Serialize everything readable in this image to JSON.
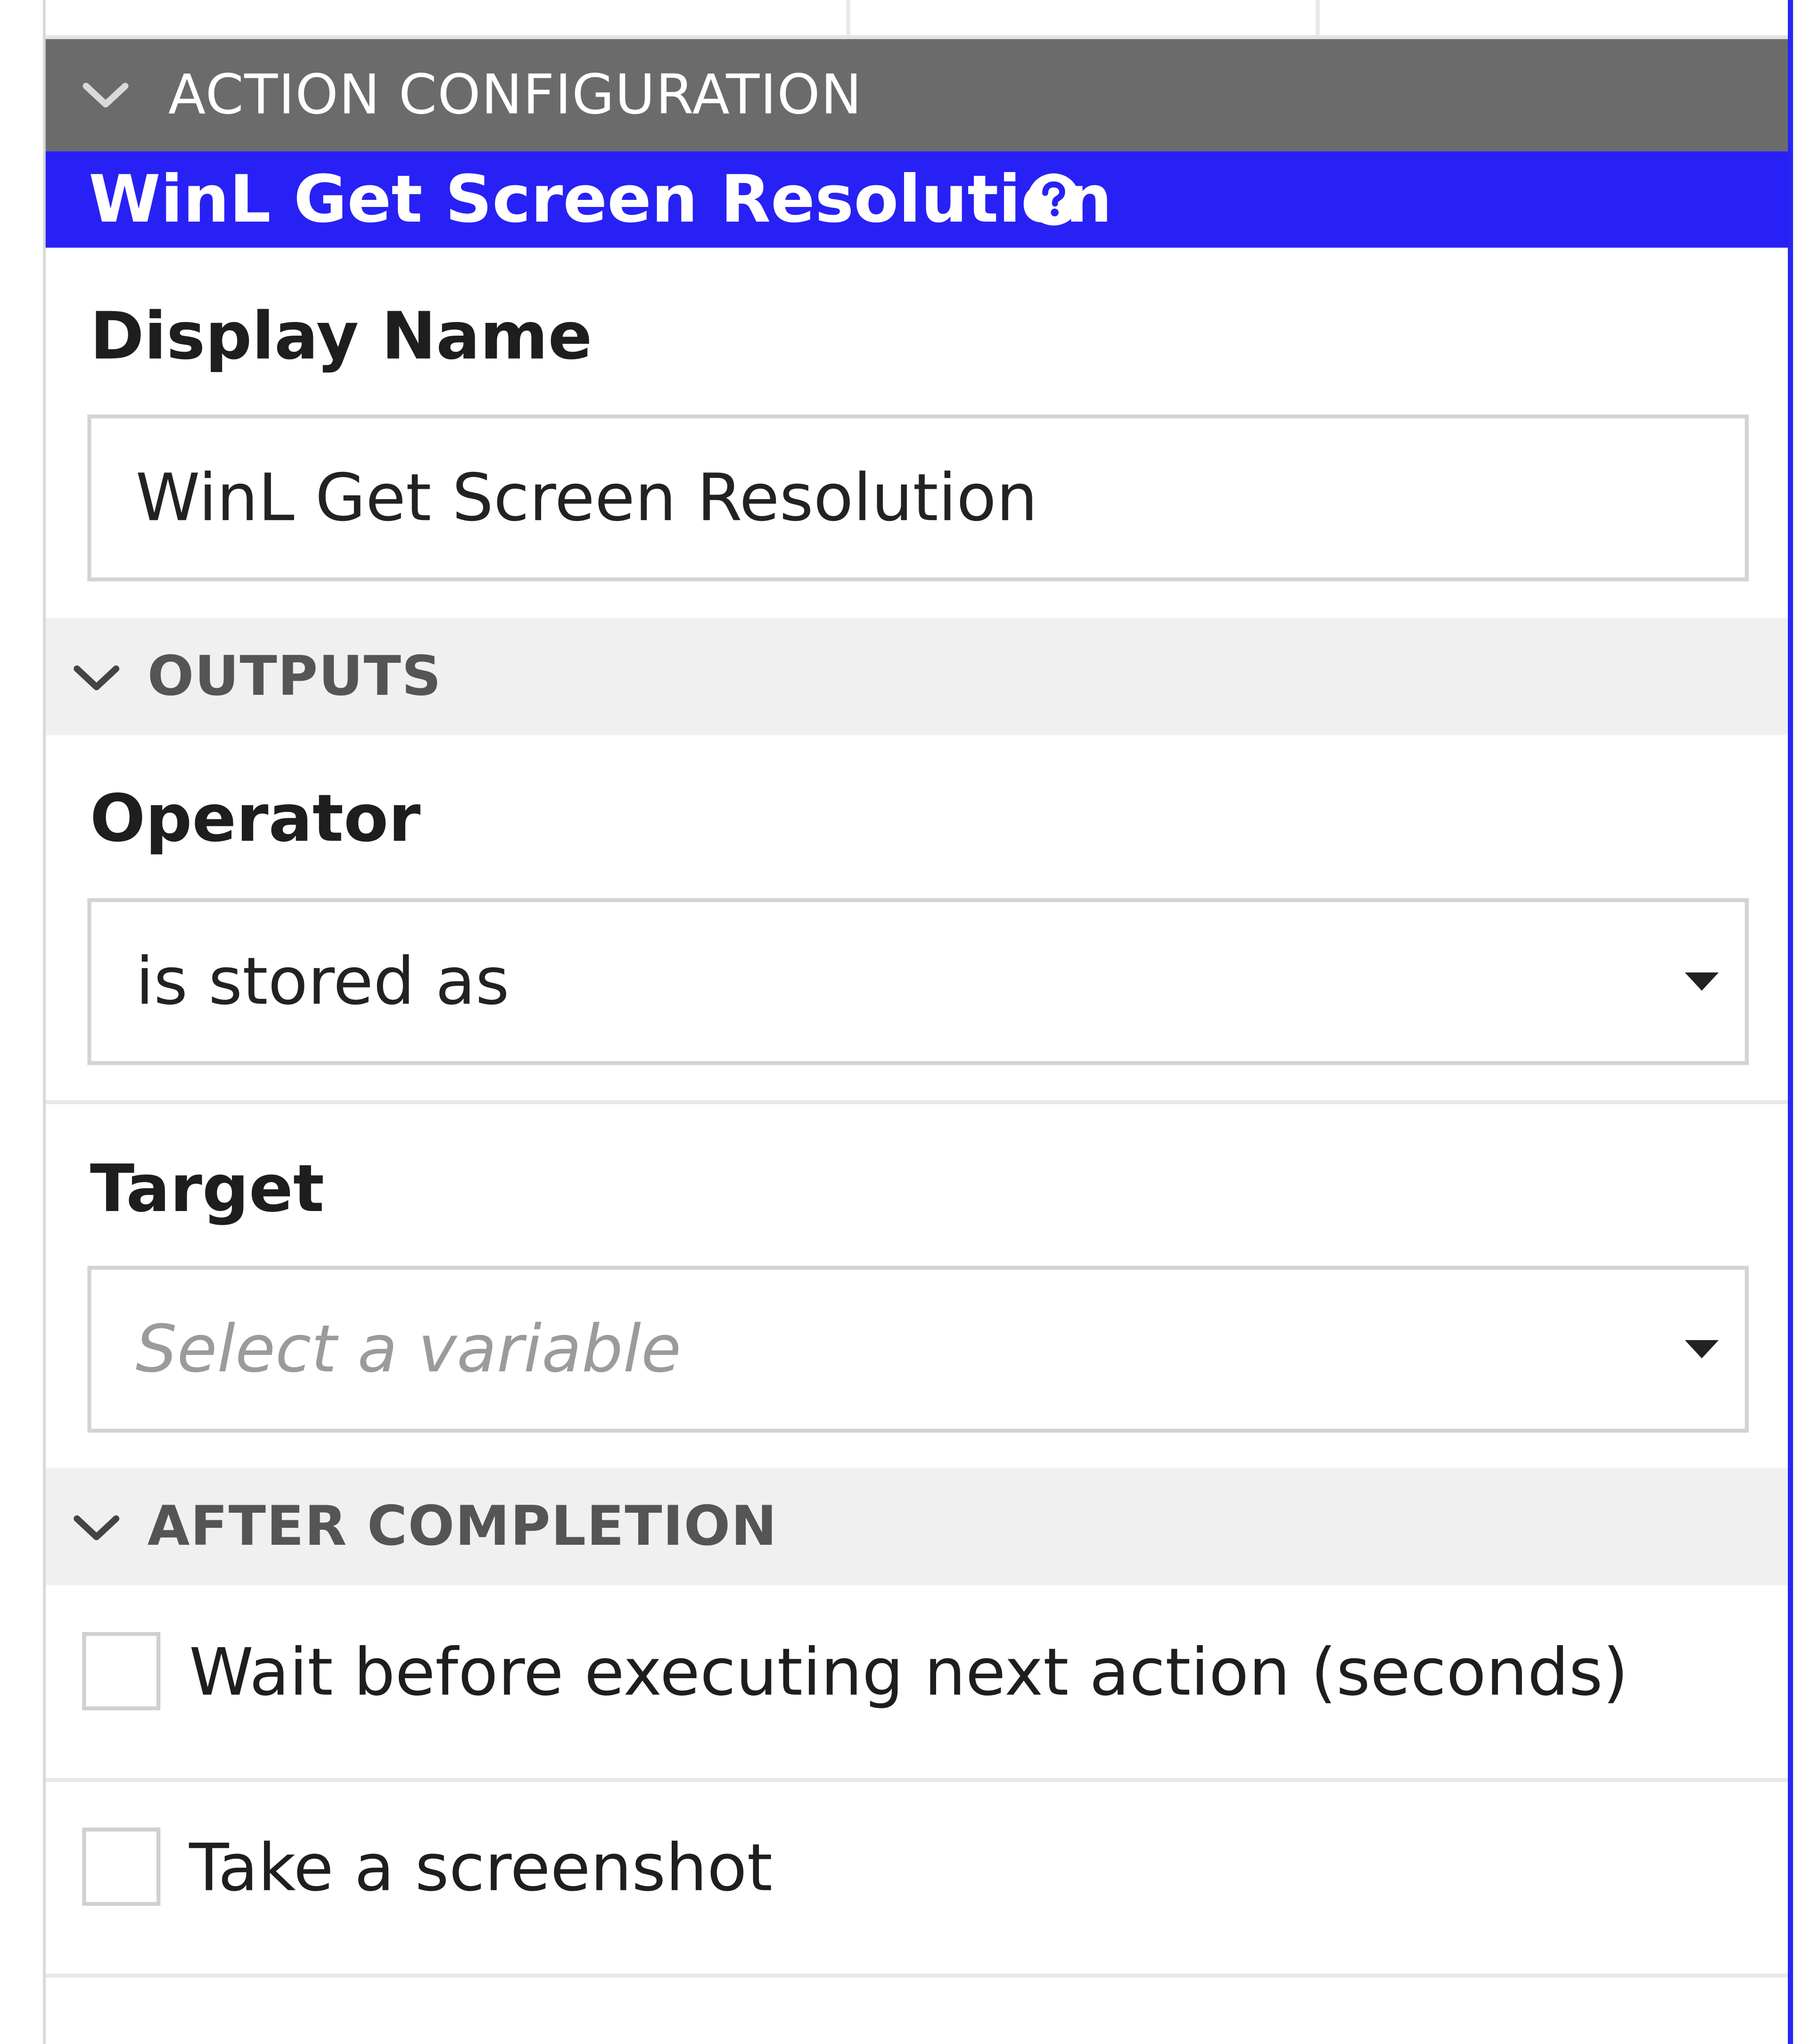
{
  "panel": {
    "header": {
      "title": "ACTION CONFIGURATION",
      "icon": "chevron-down-icon"
    },
    "action": {
      "title": "WinL Get Screen Resolution",
      "help_icon": "question-circle-icon"
    },
    "display_name": {
      "label": "Display Name",
      "value": "WinL Get Screen Resolution"
    },
    "outputs": {
      "section_title": "OUTPUTS",
      "operator": {
        "label": "Operator",
        "value": "is stored as"
      },
      "target": {
        "label": "Target",
        "placeholder": "Select a variable"
      }
    },
    "after_completion": {
      "section_title": "AFTER COMPLETION",
      "wait": {
        "label": "Wait before executing next action (seconds)",
        "checked": false
      },
      "screenshot": {
        "label": "Take a screenshot",
        "checked": false
      }
    }
  },
  "colors": {
    "header_bg": "#6b6b6b",
    "action_bar_bg": "#2821f5",
    "section_bg": "#f0f0f0",
    "field_border": "#d3d3d3"
  }
}
